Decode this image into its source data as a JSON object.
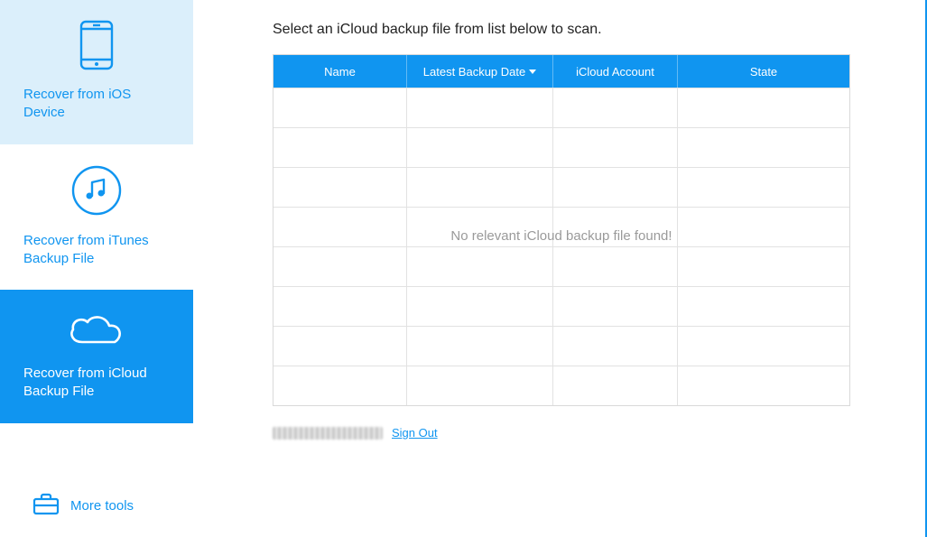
{
  "sidebar": {
    "items": [
      {
        "label": "Recover from iOS Device"
      },
      {
        "label": "Recover from iTunes Backup File"
      },
      {
        "label": "Recover from iCloud Backup File"
      }
    ],
    "more_tools": "More tools"
  },
  "main": {
    "heading": "Select an iCloud backup file from list below to scan.",
    "columns": {
      "name": "Name",
      "date": "Latest Backup Date",
      "account": "iCloud Account",
      "state": "State"
    },
    "empty_message": "No relevant iCloud backup file found!",
    "sign_out": "Sign Out"
  },
  "colors": {
    "accent": "#1095f0",
    "light": "#dbeffb"
  }
}
